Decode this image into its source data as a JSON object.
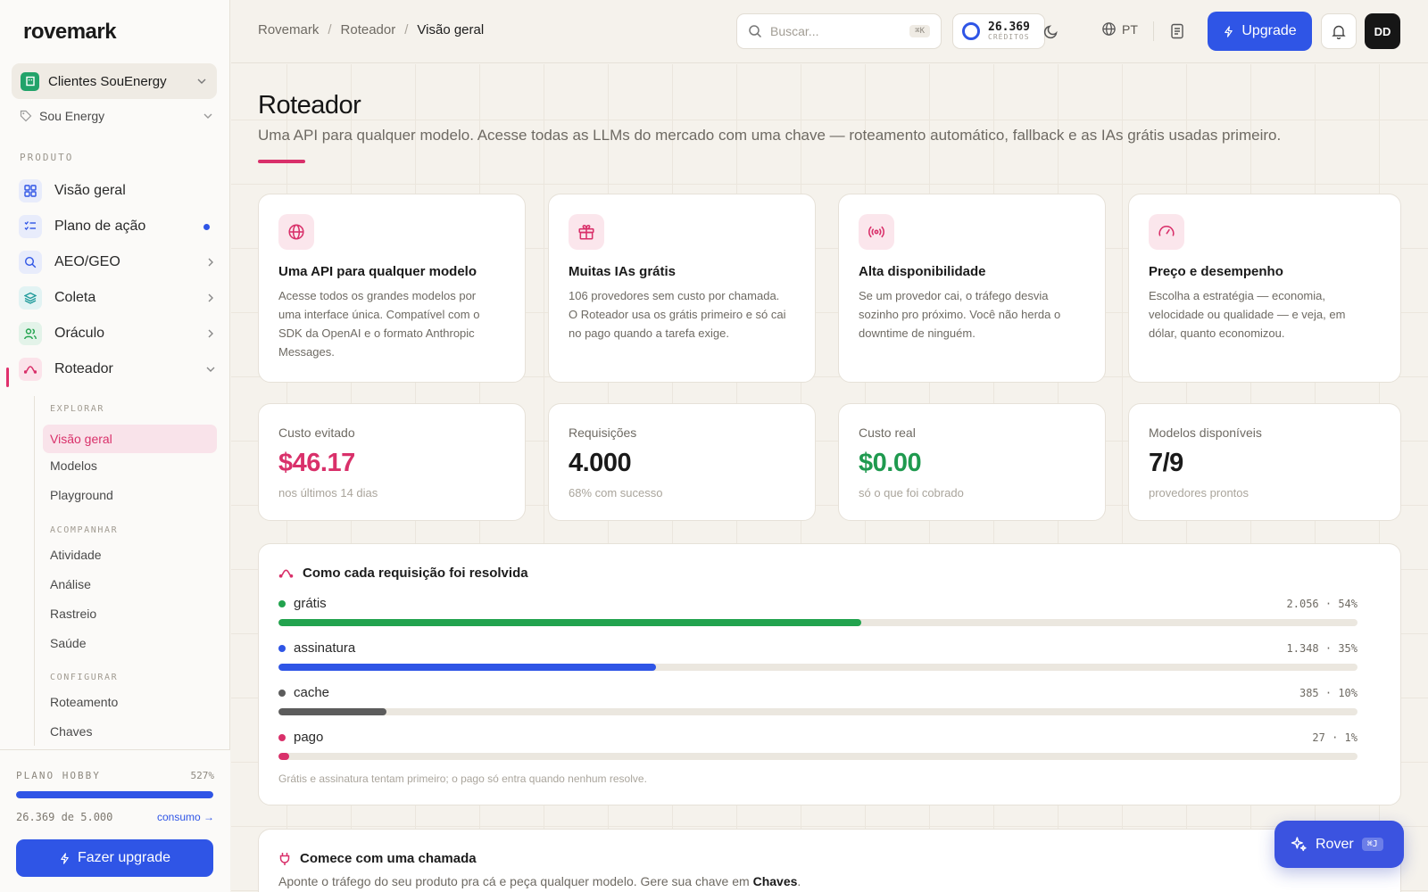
{
  "app": {
    "logo": "rovemark"
  },
  "sidebar": {
    "org": "Clientes SouEnergy",
    "sub_org": "Sou Energy",
    "section_produto": "PRODUTO",
    "items": [
      {
        "label": "Visão geral"
      },
      {
        "label": "Plano de ação"
      },
      {
        "label": "AEO/GEO"
      },
      {
        "label": "Coleta"
      },
      {
        "label": "Oráculo"
      },
      {
        "label": "Roteador"
      }
    ],
    "roteador_sections": {
      "explorar": "EXPLORAR",
      "acompanhar": "ACOMPANHAR",
      "configurar": "CONFIGURAR"
    },
    "roteador_items": {
      "visao_geral": "Visão geral",
      "modelos": "Modelos",
      "playground": "Playground",
      "atividade": "Atividade",
      "analise": "Análise",
      "rastreio": "Rastreio",
      "saude": "Saúde",
      "roteamento": "Roteamento",
      "chaves": "Chaves"
    },
    "plan": {
      "label": "PLANO HOBBY",
      "percent": "527%",
      "usage": "26.369 de 5.000",
      "link": "consumo →",
      "upgrade": "Fazer upgrade",
      "bar_fraction": 1.0
    }
  },
  "topbar": {
    "breadcrumb": [
      "Rovemark",
      "Roteador",
      "Visão geral"
    ],
    "search_placeholder": "Buscar...",
    "search_kbd": "⌘K",
    "credits_value": "26.369",
    "credits_label": "CRÉDITOS",
    "lang": "PT",
    "upgrade": "Upgrade",
    "avatar": "DD"
  },
  "page": {
    "title": "Roteador",
    "subtitle": "Uma API para qualquer modelo. Acesse todas as LLMs do mercado com uma chave — roteamento automático, fallback e as IAs grátis usadas primeiro."
  },
  "features": [
    {
      "icon": "globe-icon",
      "title": "Uma API para qualquer modelo",
      "desc": "Acesse todos os grandes modelos por uma interface única. Compatível com o SDK da OpenAI e o formato Anthropic Messages."
    },
    {
      "icon": "gift-icon",
      "title": "Muitas IAs grátis",
      "desc": "106 provedores sem custo por chamada. O Roteador usa os grátis primeiro e só cai no pago quando a tarefa exige."
    },
    {
      "icon": "broadcast-icon",
      "title": "Alta disponibilidade",
      "desc": "Se um provedor cai, o tráfego desvia sozinho pro próximo. Você não herda o downtime de ninguém."
    },
    {
      "icon": "gauge-icon",
      "title": "Preço e desempenho",
      "desc": "Escolha a estratégia — economia, velocidade ou qualidade — e veja, em dólar, quanto economizou."
    }
  ],
  "stats": [
    {
      "label": "Custo evitado",
      "value": "$46.17",
      "note": "nos últimos 14 dias",
      "color": "#d9306a"
    },
    {
      "label": "Requisições",
      "value": "4.000",
      "note": "68% com sucesso",
      "color": "#1a1a1a"
    },
    {
      "label": "Custo real",
      "value": "$0.00",
      "note": "só o que foi cobrado",
      "color": "#1f9a4f"
    },
    {
      "label": "Modelos disponíveis",
      "value": "7/9",
      "note": "provedores prontos",
      "color": "#1a1a1a"
    }
  ],
  "resolution": {
    "title": "Como cada requisição foi resolvida",
    "rows": [
      {
        "name": "grátis",
        "count": "2.056 · 54%",
        "fraction": 0.54,
        "color": "#22a34e"
      },
      {
        "name": "assinatura",
        "count": "1.348 · 35%",
        "fraction": 0.35,
        "color": "#2f55e6"
      },
      {
        "name": "cache",
        "count": "385 · 10%",
        "fraction": 0.1,
        "color": "#5c5c5c"
      },
      {
        "name": "pago",
        "count": "27 · 1%",
        "fraction": 0.01,
        "color": "#d9306a"
      }
    ],
    "footer": "Grátis e assinatura tentam primeiro; o pago só entra quando nenhum resolve."
  },
  "start": {
    "title": "Comece com uma chamada",
    "desc_prefix": "Aponte o tráfego do seu produto pra cá e peça qualquer modelo. Gere sua chave em ",
    "desc_link": "Chaves",
    "desc_suffix": "."
  },
  "rover": {
    "label": "Rover",
    "kbd": "⌘J"
  }
}
